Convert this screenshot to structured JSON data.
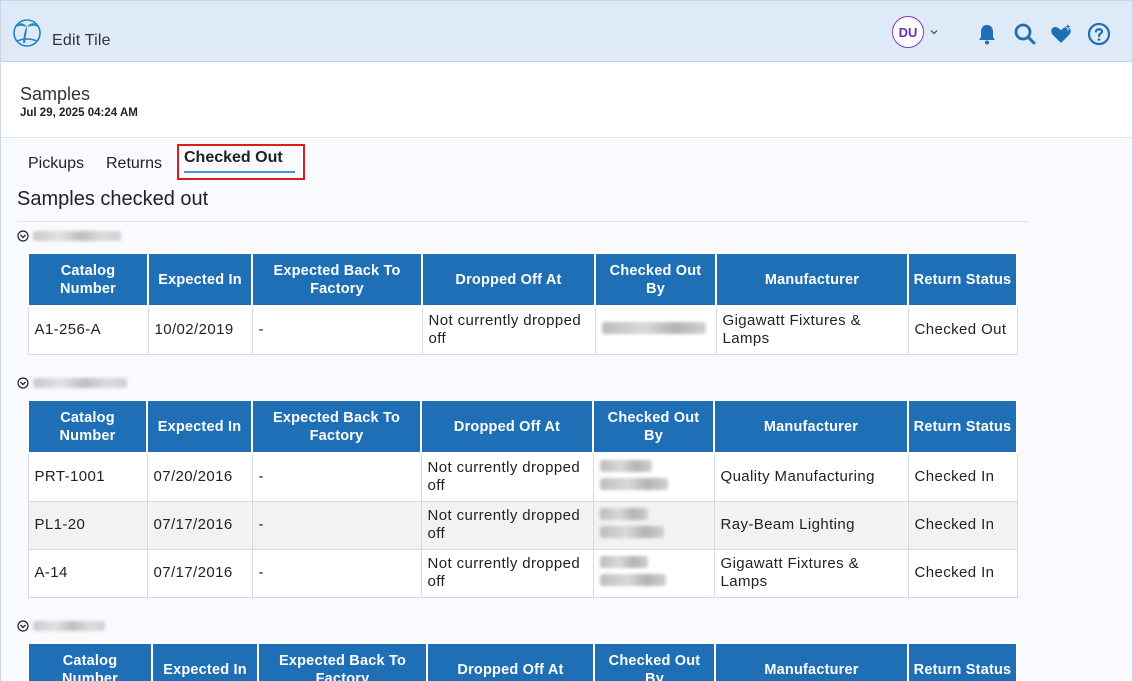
{
  "header": {
    "app_title": "Edit Tile",
    "avatar_initials": "DU",
    "brand_color": "#1e6fb5",
    "accent_color": "#7a3fbf"
  },
  "page": {
    "title": "Samples",
    "date": "Jul 29, 2025 04:24 AM"
  },
  "tabs": [
    {
      "label": "Pickups",
      "active": false
    },
    {
      "label": "Returns",
      "active": false
    },
    {
      "label": "Checked Out",
      "active": true
    }
  ],
  "section_title": "Samples checked out",
  "columns": [
    "Catalog Number",
    "Expected In",
    "Expected Back To Factory",
    "Dropped Off At",
    "Checked Out By",
    "Manufacturer",
    "Return Status"
  ],
  "groups": [
    {
      "rows": [
        {
          "catalog": "A1-256-A",
          "expected_in": "10/02/2019",
          "expected_back": "-",
          "dropped_off": "Not currently dropped off",
          "manufacturer": "Gigawatt Fixtures & Lamps",
          "status": "Checked Out"
        }
      ]
    },
    {
      "rows": [
        {
          "catalog": "PRT-1001",
          "expected_in": "07/20/2016",
          "expected_back": "-",
          "dropped_off": "Not currently dropped off",
          "manufacturer": "Quality Manufacturing",
          "status": "Checked In"
        },
        {
          "catalog": "PL1-20",
          "expected_in": "07/17/2016",
          "expected_back": "-",
          "dropped_off": "Not currently dropped off",
          "manufacturer": "Ray-Beam Lighting",
          "status": "Checked In"
        },
        {
          "catalog": "A-14",
          "expected_in": "07/17/2016",
          "expected_back": "-",
          "dropped_off": "Not currently dropped off",
          "manufacturer": "Gigawatt Fixtures & Lamps",
          "status": "Checked In"
        }
      ]
    },
    {
      "rows": []
    }
  ]
}
